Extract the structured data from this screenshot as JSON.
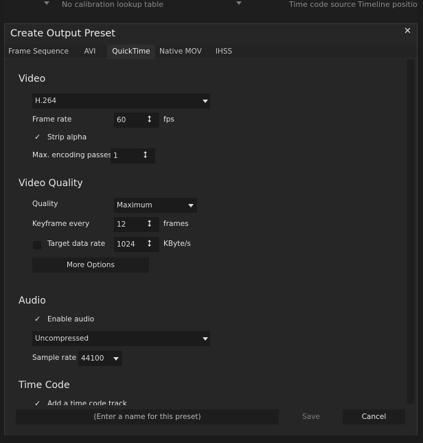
{
  "background": {
    "lookup_table": "No calibration lookup table",
    "time_code_source": "Time code source",
    "timeline_position": "Timeline position"
  },
  "dialog": {
    "title": "Create Output Preset",
    "close_glyph": "✕"
  },
  "tabs": [
    {
      "label": "Frame Sequence",
      "active": false
    },
    {
      "label": "AVI",
      "active": false
    },
    {
      "label": "QuickTime",
      "active": true
    },
    {
      "label": "Native MOV",
      "active": false
    },
    {
      "label": "IHSS",
      "active": false
    }
  ],
  "video": {
    "heading": "Video",
    "codec": "H.264",
    "frame_rate_label": "Frame rate",
    "frame_rate_value": "60",
    "frame_rate_unit": "fps",
    "strip_alpha_label": "Strip alpha",
    "strip_alpha_checked": true,
    "passes_label": "Max. encoding passes",
    "passes_value": "1"
  },
  "video_quality": {
    "heading": "Video Quality",
    "quality_label": "Quality",
    "quality_value": "Maximum",
    "keyframe_label": "Keyframe every",
    "keyframe_value": "12",
    "keyframe_unit": "frames",
    "target_rate_label": "Target data rate",
    "target_rate_checked": false,
    "target_rate_value": "1024",
    "target_rate_unit": "KByte/s",
    "more_options_label": "More Options"
  },
  "audio": {
    "heading": "Audio",
    "enable_label": "Enable audio",
    "enable_checked": true,
    "format_value": "Uncompressed",
    "sample_rate_label": "Sample rate",
    "sample_rate_value": "44100"
  },
  "time_code": {
    "heading": "Time Code",
    "track_label": "Add a time code track"
  },
  "footer": {
    "name_placeholder": "(Enter a name for this preset)",
    "save_label": "Save",
    "cancel_label": "Cancel"
  },
  "icons": {
    "check": "✓",
    "stepper": "⭥",
    "dropdown": "chevron-down-icon"
  }
}
